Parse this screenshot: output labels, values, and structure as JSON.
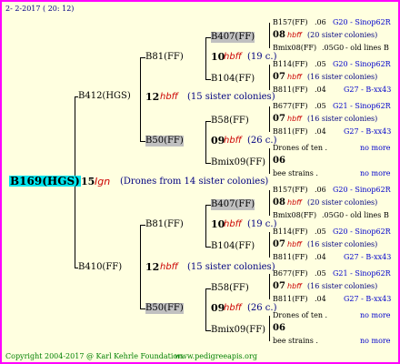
{
  "header": {
    "date": "2- 2-2017 ( 20: 12)"
  },
  "root": {
    "id": "B169(HGS)",
    "gen": "15",
    "gen_mark": "Ign",
    "note": "(Drones from 14 sister colonies)"
  },
  "top": {
    "id": "B412(HGS)",
    "gen": "12",
    "gen_mark": "hbff",
    "note": "(15 sister colonies)",
    "a": {
      "id": "B81(FF)",
      "gen": "10",
      "gen_mark": "hbff",
      "note": "(19 c.)",
      "a": {
        "id": "B407(FF)",
        "gen": "08",
        "gen_mark": "hbff",
        "note": "(20 sister colonies)",
        "r1": {
          "id": "B157(FF)",
          "num": ".06",
          "info": "G20 - Sinop62R"
        },
        "r2": {
          "id": "Bmix08(FF)",
          "num": ".05G0",
          "info": "- old lines B"
        }
      },
      "b": {
        "id": "B104(FF)",
        "gen": "07",
        "gen_mark": "hbff",
        "note": "(16 sister colonies)",
        "r1": {
          "id": "B114(FF)",
          "num": ".05",
          "info": "G20 - Sinop62R"
        },
        "r2": {
          "id": "B811(FF)",
          "num": ".04",
          "info": "G27 - B-xx43"
        }
      }
    },
    "b": {
      "id": "B50(FF)",
      "gen": "09",
      "gen_mark": "hbff",
      "note": "(26 c.)",
      "a": {
        "id": "B58(FF)",
        "gen": "07",
        "gen_mark": "hbff",
        "note": "(16 sister colonies)",
        "r1": {
          "id": "B677(FF)",
          "num": ".05",
          "info": "G21 - Sinop62R"
        },
        "r2": {
          "id": "B811(FF)",
          "num": ".04",
          "info": "G27 - B-xx43"
        }
      },
      "b": {
        "id": "Bmix09(FF)",
        "gen": "06",
        "r1": {
          "label": "Drones of ten .",
          "more": "no more"
        },
        "r2": {
          "label": "bee strains .",
          "more": "no more"
        }
      }
    }
  },
  "bottom": {
    "id": "B410(FF)",
    "gen": "12",
    "gen_mark": "hbff",
    "note": "(15 sister colonies)",
    "a": {
      "id": "B81(FF)",
      "gen": "10",
      "gen_mark": "hbff",
      "note": "(19 c.)",
      "a": {
        "id": "B407(FF)",
        "gen": "08",
        "gen_mark": "hbff",
        "note": "(20 sister colonies)",
        "r1": {
          "id": "B157(FF)",
          "num": ".06",
          "info": "G20 - Sinop62R"
        },
        "r2": {
          "id": "Bmix08(FF)",
          "num": ".05G0",
          "info": "- old lines B"
        }
      },
      "b": {
        "id": "B104(FF)",
        "gen": "07",
        "gen_mark": "hbff",
        "note": "(16 sister colonies)",
        "r1": {
          "id": "B114(FF)",
          "num": ".05",
          "info": "G20 - Sinop62R"
        },
        "r2": {
          "id": "B811(FF)",
          "num": ".04",
          "info": "G27 - B-xx43"
        }
      }
    },
    "b": {
      "id": "B50(FF)",
      "gen": "09",
      "gen_mark": "hbff",
      "note": "(26 c.)",
      "a": {
        "id": "B58(FF)",
        "gen": "07",
        "gen_mark": "hbff",
        "note": "(16 sister colonies)",
        "r1": {
          "id": "B677(FF)",
          "num": ".05",
          "info": "G21 - Sinop62R"
        },
        "r2": {
          "id": "B811(FF)",
          "num": ".04",
          "info": "G27 - B-xx43"
        }
      },
      "b": {
        "id": "Bmix09(FF)",
        "gen": "06",
        "r1": {
          "label": "Drones of ten .",
          "more": "no more"
        },
        "r2": {
          "label": "bee strains .",
          "more": "no more"
        }
      }
    }
  },
  "footer": {
    "copyright": "Copyright 2004-2017 @ Karl Kehrle Foundation.",
    "site": "www.pedigreeapis.org"
  },
  "colors": {
    "border": "#ff00ff",
    "background": "#ffffe0",
    "root_highlight": "#00e5ee",
    "gray_box": "#c0c0c0",
    "gen_red": "#cc0000",
    "info_blue": "#0000cc",
    "footer_green": "#008000"
  }
}
